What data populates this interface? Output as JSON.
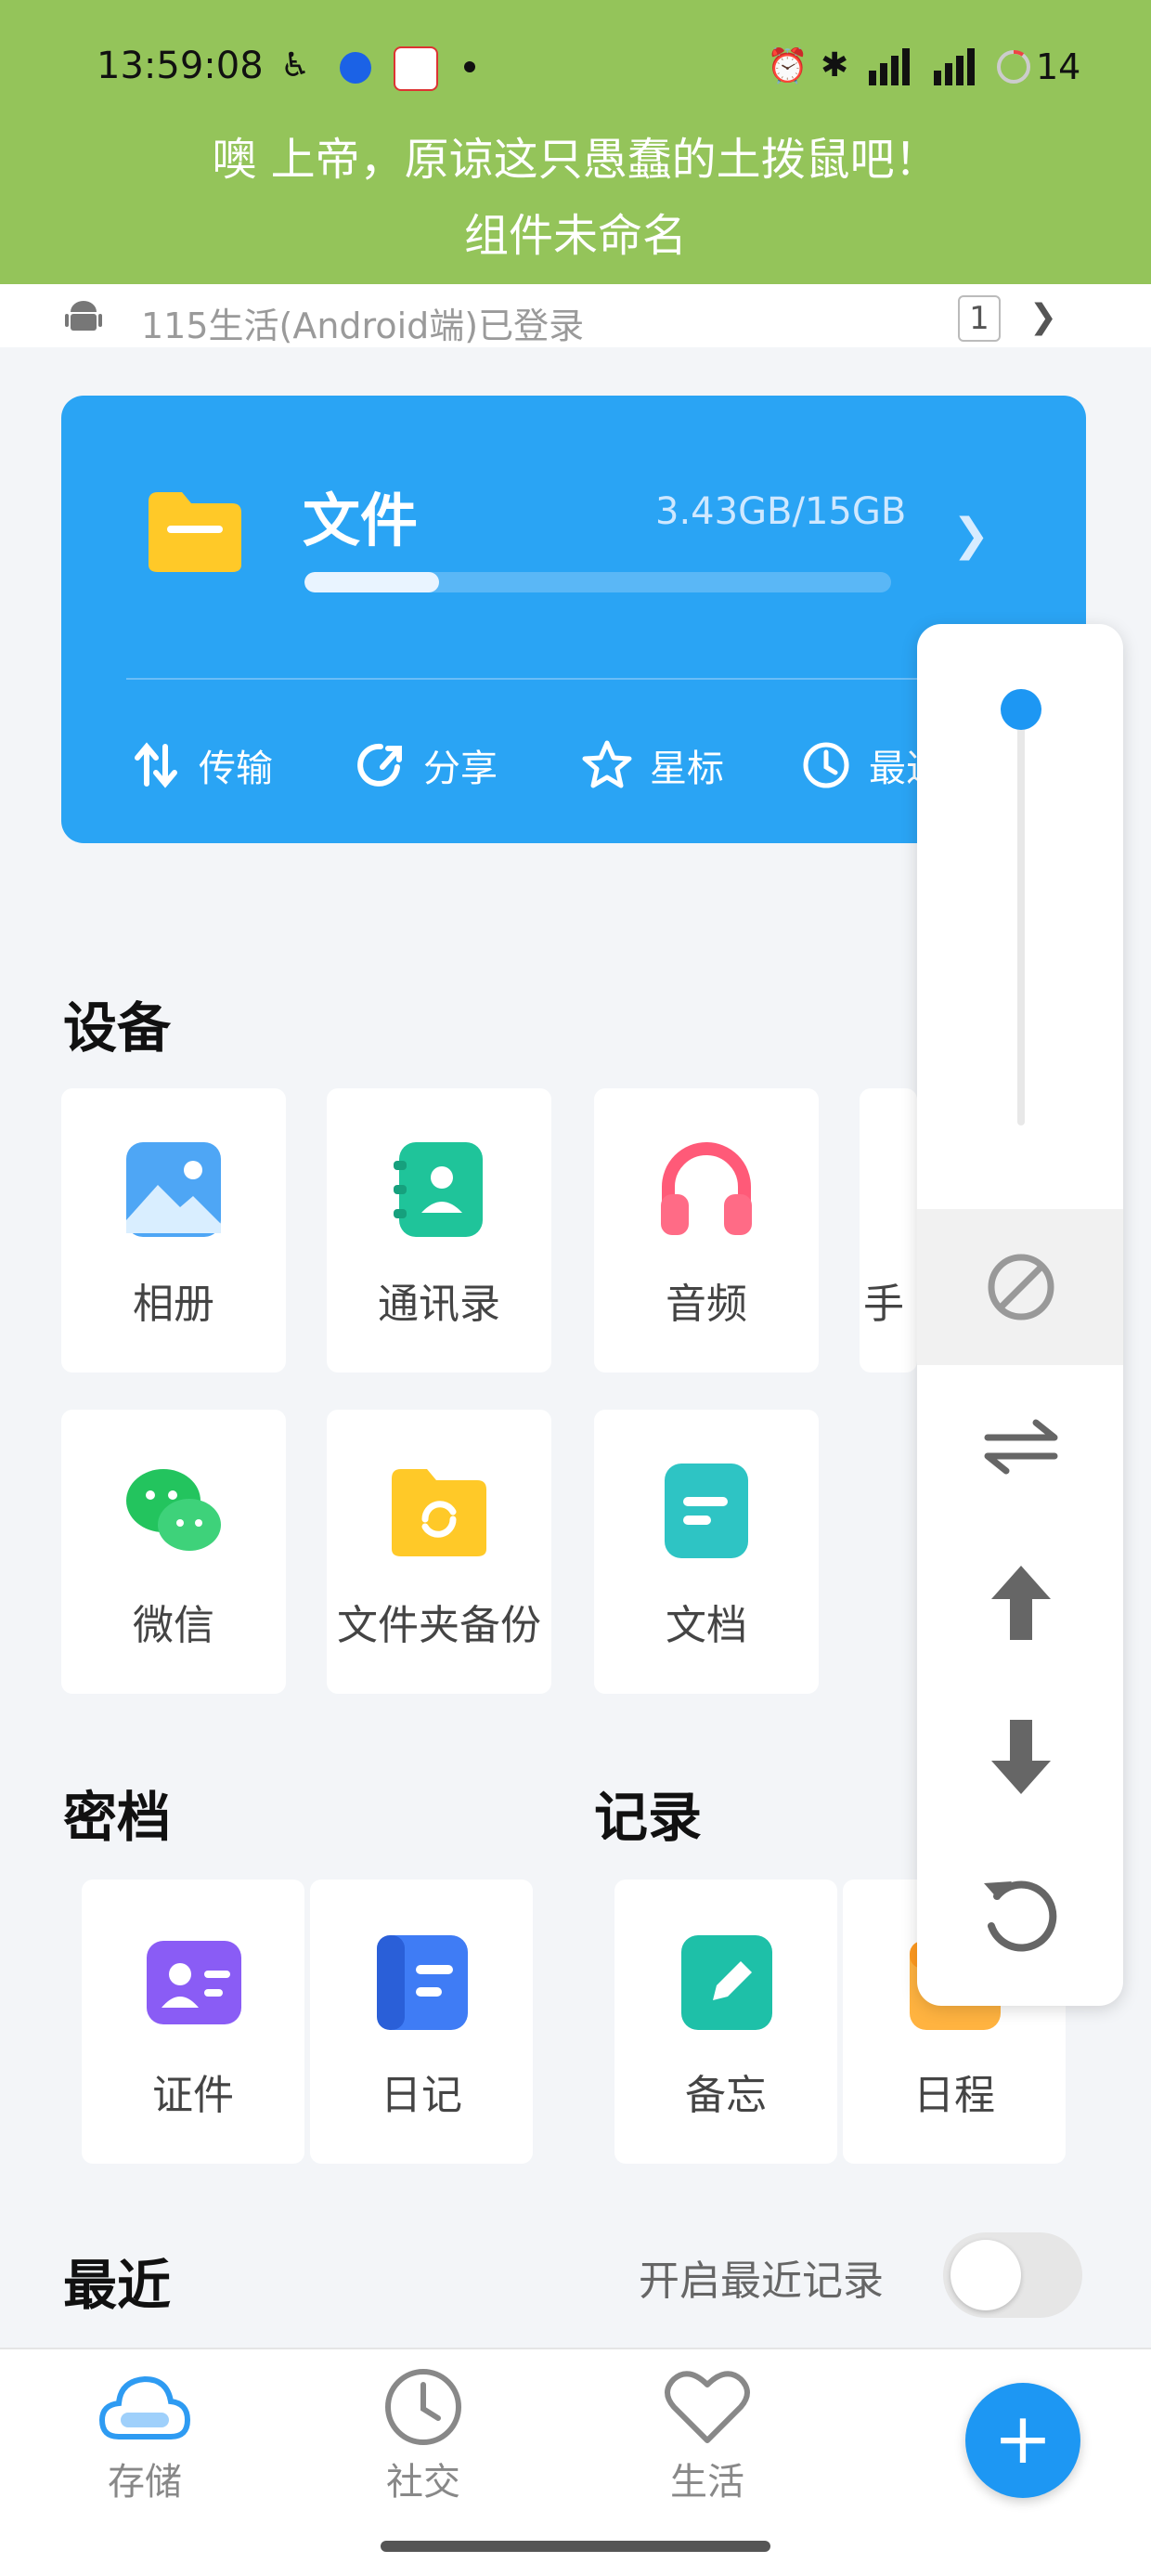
{
  "status_bar": {
    "time": "13:59:08",
    "battery": "14"
  },
  "banner": {
    "line1": "噢 上帝，原谅这只愚蠢的土拨鼠吧！",
    "line2": "组件未命名"
  },
  "login": {
    "text": "115生活(Android端)已登录",
    "count": "1"
  },
  "files_card": {
    "title": "文件",
    "usage": "3.43GB/15GB",
    "usage_fraction": 0.23,
    "actions": [
      {
        "label": "传输",
        "icon": "transfer-icon"
      },
      {
        "label": "分享",
        "icon": "share-icon"
      },
      {
        "label": "星标",
        "icon": "star-icon"
      },
      {
        "label": "最近",
        "icon": "history-icon"
      }
    ]
  },
  "sections": {
    "devices": "设备",
    "vault": "密档",
    "records": "记录",
    "recent": "最近"
  },
  "devices": [
    {
      "label": "相册",
      "icon": "photo-icon"
    },
    {
      "label": "通讯录",
      "icon": "contacts-icon"
    },
    {
      "label": "音频",
      "icon": "headphones-icon"
    },
    {
      "label": "手",
      "icon": "phone-icon"
    },
    {
      "label": "微信",
      "icon": "wechat-icon"
    },
    {
      "label": "文件夹备份",
      "icon": "folder-sync-icon"
    },
    {
      "label": "文档",
      "icon": "document-icon"
    }
  ],
  "vault": [
    {
      "label": "证件",
      "icon": "id-card-icon"
    },
    {
      "label": "日记",
      "icon": "diary-icon"
    }
  ],
  "records": [
    {
      "label": "备忘",
      "icon": "memo-icon"
    },
    {
      "label": "日程",
      "icon": "schedule-icon"
    }
  ],
  "recent": {
    "toggle_label": "开启最近记录",
    "enabled": false
  },
  "bottom_nav": [
    {
      "label": "存储",
      "icon": "cloud-icon"
    },
    {
      "label": "社交",
      "icon": "clock-icon"
    },
    {
      "label": "生活",
      "icon": "heart-icon"
    }
  ],
  "colors": {
    "banner": "#94c45a",
    "accent": "#1d97f3",
    "card": "#2aa4f4"
  }
}
